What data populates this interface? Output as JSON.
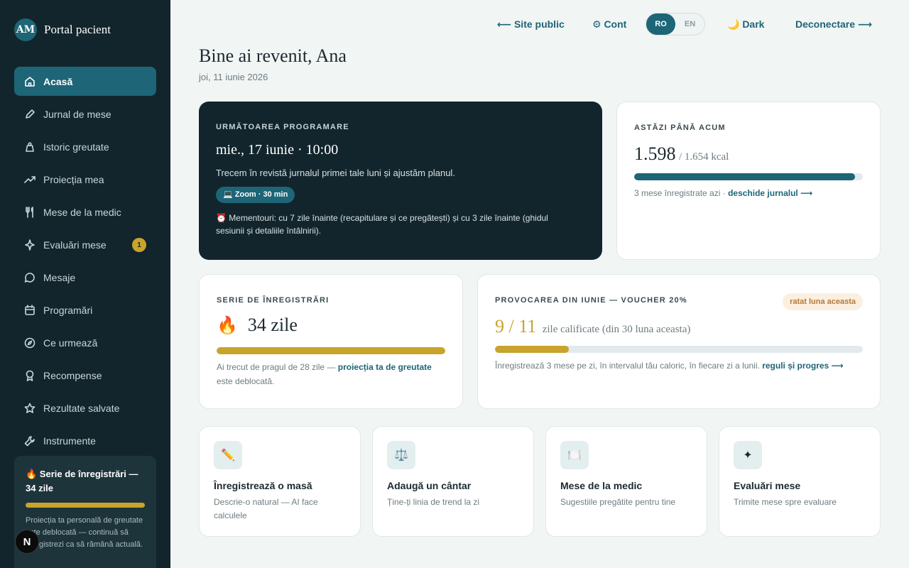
{
  "brand": {
    "initials": "AM",
    "name": "Portal pacient"
  },
  "nav": [
    {
      "label": "Acasă",
      "icon": "home-icon",
      "active": true
    },
    {
      "label": "Jurnal de mese",
      "icon": "pencil-icon"
    },
    {
      "label": "Istoric greutate",
      "icon": "weight-icon"
    },
    {
      "label": "Proiecția mea",
      "icon": "trend-icon"
    },
    {
      "label": "Mese de la medic",
      "icon": "utensils-icon"
    },
    {
      "label": "Evaluări mese",
      "icon": "sparkle-icon",
      "badge": "1"
    },
    {
      "label": "Mesaje",
      "icon": "chat-icon"
    },
    {
      "label": "Programări",
      "icon": "calendar-icon"
    },
    {
      "label": "Ce urmează",
      "icon": "compass-icon"
    },
    {
      "label": "Recompense",
      "icon": "award-icon"
    },
    {
      "label": "Rezultate salvate",
      "icon": "star-icon"
    },
    {
      "label": "Instrumente",
      "icon": "wrench-icon"
    }
  ],
  "sidebar_streak": {
    "title": "🔥 Serie de înregistrări — 34 zile",
    "text": "Proiecția ta personală de greutate este deblocată — continuă să înregistrezi ca să rămână actuală."
  },
  "topbar": {
    "public_site": "⟵ Site public",
    "account": "⚙ Cont",
    "lang_ro": "RO",
    "lang_en": "EN",
    "dark": "🌙 Dark",
    "logout": "Deconectare ⟶"
  },
  "header": {
    "greeting": "Bine ai revenit, Ana",
    "date": "joi, 11 iunie 2026"
  },
  "appointment": {
    "eyebrow": "URMĂTOAREA PROGRAMARE",
    "when": "mie., 17 iunie · 10:00",
    "desc": "Trecem în revistă jurnalul primei tale luni și ajustăm planul.",
    "pill": "💻 Zoom · 30 min",
    "note": "⏰ Mementouri: cu 7 zile înainte (recapitulare și ce pregătești) și cu 3 zile înainte (ghidul sesiunii și detaliile întâlnirii)."
  },
  "today": {
    "eyebrow": "ASTĂZI PÂNĂ ACUM",
    "value": "1.598",
    "target": "/ 1.654 kcal",
    "progress": 0.966,
    "note": "3 mese înregistrate azi · ",
    "link": "deschide jurnalul ⟶"
  },
  "streak": {
    "eyebrow": "SERIE DE ÎNREGISTRĂRI",
    "emoji": "🔥",
    "value": "34 zile",
    "progress": 1.0,
    "note": "Ai trecut de pragul de 28 zile — ",
    "link": "proiecția ta de greutate",
    "note_end": " este deblocată."
  },
  "challenge": {
    "eyebrow": "PROVOCAREA DIN IUNIE — VOUCHER 20%",
    "badge": "ratat luna aceasta",
    "value": "9 / 11",
    "sub": "zile calificate (din 30 luna aceasta)",
    "progress": 0.2,
    "note": "Înregistrează 3 mese pe zi, în intervalul tău caloric, în fiecare zi a lunii. ",
    "link": "reguli și progres ⟶"
  },
  "actions": [
    {
      "icon": "✏️",
      "title": "Înregistrează o masă",
      "sub": "Descrie-o natural — AI face calculele"
    },
    {
      "icon": "⚖️",
      "title": "Adaugă un cântar",
      "sub": "Ține-ți linia de trend la zi"
    },
    {
      "icon": "🍽️",
      "title": "Mese de la medic",
      "sub": "Sugestiile pregătite pentru tine"
    },
    {
      "icon": "✦",
      "title": "Evaluări mese",
      "sub": "Trimite mese spre evaluare"
    }
  ],
  "colors": {
    "accent": "#1d6577",
    "gold": "#c9a42c",
    "sidebar": "#12252c"
  }
}
